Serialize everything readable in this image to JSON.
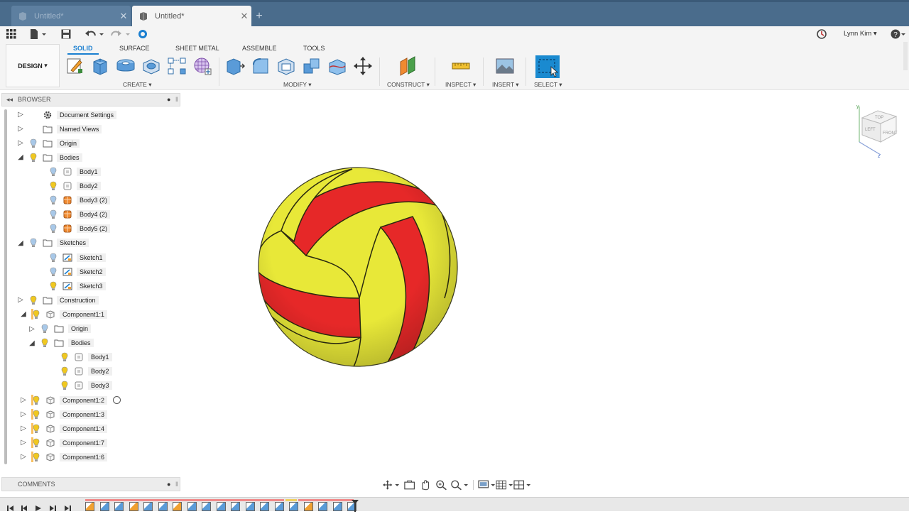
{
  "tabs": [
    {
      "label": "Untitled*",
      "state": "inactive"
    },
    {
      "label": "Untitled*",
      "state": "active"
    }
  ],
  "new_tab_icon": "plus-icon",
  "user": {
    "name": "Lynn Kim"
  },
  "toolbar": {
    "workspace": "DESIGN",
    "workspace_tabs": [
      "SOLID",
      "SURFACE",
      "SHEET METAL",
      "ASSEMBLE",
      "TOOLS"
    ],
    "active_tab": "SOLID",
    "groups": {
      "create": "CREATE",
      "modify": "MODIFY",
      "construct": "CONSTRUCT",
      "inspect": "INSPECT",
      "insert": "INSERT",
      "select": "SELECT"
    }
  },
  "browser": {
    "title": "BROWSER",
    "tree": [
      {
        "label": "Document Settings",
        "expanded": false,
        "icon": "gear-icon"
      },
      {
        "label": "Named Views",
        "expanded": false,
        "icon": "folder-icon"
      },
      {
        "label": "Origin",
        "expanded": false,
        "icon": "folder-icon"
      },
      {
        "label": "Bodies",
        "expanded": true,
        "icon": "folder-icon"
      },
      {
        "label": "Body1",
        "icon": "body-icon"
      },
      {
        "label": "Body2",
        "icon": "body-icon"
      },
      {
        "label": "Body3 (2)",
        "icon": "body-orange-icon"
      },
      {
        "label": "Body4 (2)",
        "icon": "body-orange-icon"
      },
      {
        "label": "Body5 (2)",
        "icon": "body-orange-icon"
      },
      {
        "label": "Sketches",
        "expanded": true,
        "icon": "folder-icon"
      },
      {
        "label": "Sketch1",
        "icon": "sketch-icon"
      },
      {
        "label": "Sketch2",
        "icon": "sketch-icon"
      },
      {
        "label": "Sketch3",
        "icon": "sketch-icon"
      },
      {
        "label": "Construction",
        "expanded": false,
        "icon": "folder-icon"
      },
      {
        "label": "Component1:1",
        "expanded": true,
        "icon": "component-icon"
      },
      {
        "label": "Origin",
        "expanded": false,
        "icon": "folder-icon"
      },
      {
        "label": "Bodies",
        "expanded": true,
        "icon": "folder-icon"
      },
      {
        "label": "Body1",
        "icon": "body-icon"
      },
      {
        "label": "Body2",
        "icon": "body-icon"
      },
      {
        "label": "Body3",
        "icon": "body-icon"
      },
      {
        "label": "Component1:2",
        "expanded": false,
        "icon": "component-icon"
      },
      {
        "label": "Component1:3",
        "expanded": false,
        "icon": "component-icon"
      },
      {
        "label": "Component1:4",
        "expanded": false,
        "icon": "component-icon"
      },
      {
        "label": "Component1:7",
        "expanded": false,
        "icon": "component-icon"
      },
      {
        "label": "Component1:6",
        "expanded": false,
        "icon": "component-icon"
      }
    ]
  },
  "comments": {
    "title": "COMMENTS"
  },
  "viewcube": {
    "top": "TOP",
    "front": "FRONT",
    "left": "LEFT"
  },
  "colors": {
    "tabbar": "#4a6c8c",
    "accent": "#1a7fd0",
    "ball_yellow": "#e8e838",
    "ball_red": "#e62828"
  }
}
